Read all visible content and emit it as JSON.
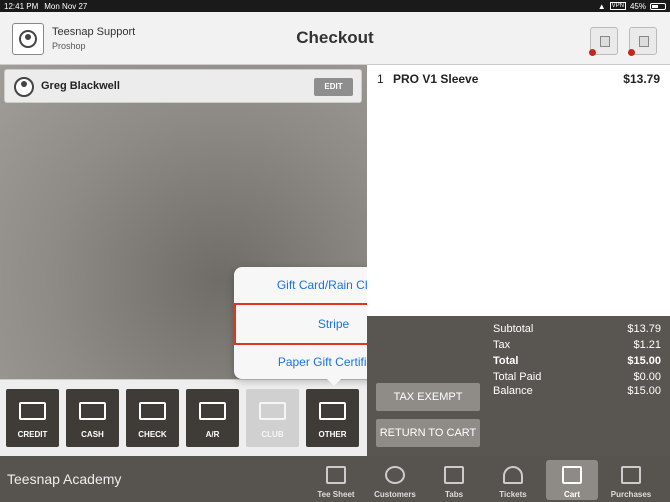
{
  "status_bar": {
    "time": "12:41 PM",
    "date": "Mon Nov 27",
    "vpn": "VPN",
    "battery": "45%"
  },
  "header": {
    "account_name": "Teesnap Support",
    "account_sub": "Proshop",
    "title": "Checkout"
  },
  "customer": {
    "name": "Greg  Blackwell",
    "edit_label": "EDIT"
  },
  "cart_items": [
    {
      "qty": "1",
      "name": "PRO V1 Sleeve",
      "price": "$13.79"
    }
  ],
  "payment_methods": [
    {
      "label": "CREDIT",
      "enabled": true,
      "icon": "credit-card-icon"
    },
    {
      "label": "CASH",
      "enabled": true,
      "icon": "cash-icon"
    },
    {
      "label": "CHECK",
      "enabled": true,
      "icon": "check-icon"
    },
    {
      "label": "A/R",
      "enabled": true,
      "icon": "ledger-icon"
    },
    {
      "label": "CLUB",
      "enabled": false,
      "icon": "ticket-icon"
    },
    {
      "label": "OTHER",
      "enabled": true,
      "icon": "other-payment-icon"
    }
  ],
  "other_popover": {
    "items": [
      "Gift Card/Rain Check",
      "Stripe",
      "Paper Gift Certificate"
    ],
    "highlighted_index": 1
  },
  "totals": {
    "tax_exempt_label": "TAX EXEMPT",
    "return_label": "RETURN TO CART",
    "rows": [
      {
        "label": "Subtotal",
        "value": "$13.79",
        "bold": false
      },
      {
        "label": "Tax",
        "value": "$1.21",
        "bold": false
      },
      {
        "label": "Total",
        "value": "$15.00",
        "bold": true
      },
      {
        "label": "Total Paid",
        "value": "$0.00",
        "bold": false
      },
      {
        "label": "Balance",
        "value": "$15.00",
        "bold": false
      }
    ]
  },
  "tabbar": {
    "brand": "Teesnap Academy",
    "tabs": [
      {
        "label": "Tee Sheet",
        "icon": "calendar-icon",
        "active": false
      },
      {
        "label": "Customers",
        "icon": "customers-icon",
        "active": false
      },
      {
        "label": "Tabs",
        "icon": "tabs-icon",
        "active": false
      },
      {
        "label": "Tickets",
        "icon": "bell-icon",
        "active": false
      },
      {
        "label": "Cart",
        "icon": "cart-icon",
        "active": true
      },
      {
        "label": "Purchases",
        "icon": "register-icon",
        "active": false
      }
    ]
  },
  "colors": {
    "accent_link": "#1a73e8",
    "highlight_border": "#e0351e",
    "dark_button": "#3f3c38",
    "alert_dot": "#c0281e"
  }
}
